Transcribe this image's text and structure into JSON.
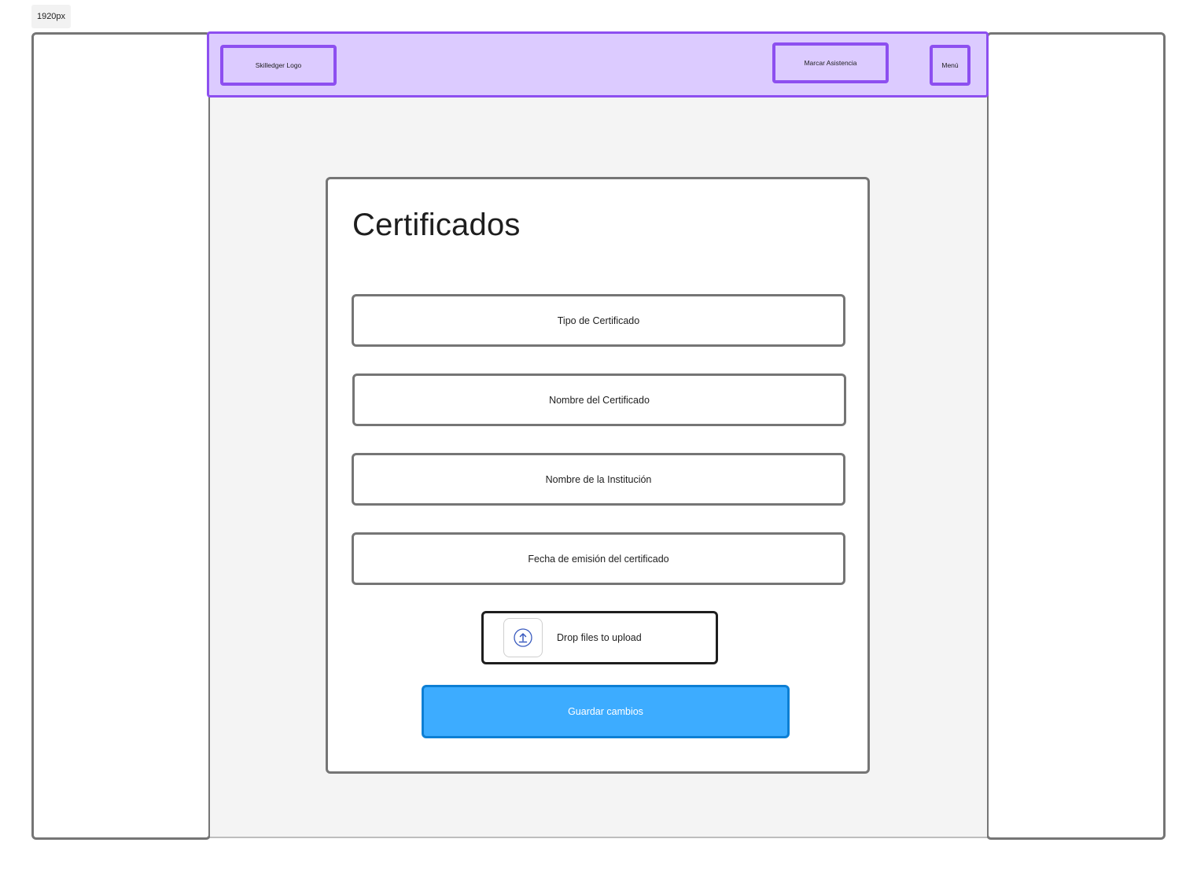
{
  "frame": {
    "label": "1920px"
  },
  "header": {
    "logo_label": "Skilledger Logo",
    "attendance_label": "Marcar Asistencia",
    "menu_label": "Menú"
  },
  "form": {
    "title": "Certificados",
    "fields": [
      {
        "label": "Tipo de Certificado"
      },
      {
        "label": "Nombre del Certificado"
      },
      {
        "label": "Nombre de la Institución"
      },
      {
        "label": "Fecha de emisión del certificado"
      }
    ],
    "upload": {
      "label": "Drop files to upload",
      "icon": "upload-icon"
    },
    "save_label": "Guardar cambios"
  },
  "colors": {
    "header_bg": "#dccbff",
    "header_border": "#8d4ff0",
    "primary_button": "#3dacff",
    "primary_button_border": "#0d7fd4",
    "main_bg": "#f4f4f4"
  }
}
